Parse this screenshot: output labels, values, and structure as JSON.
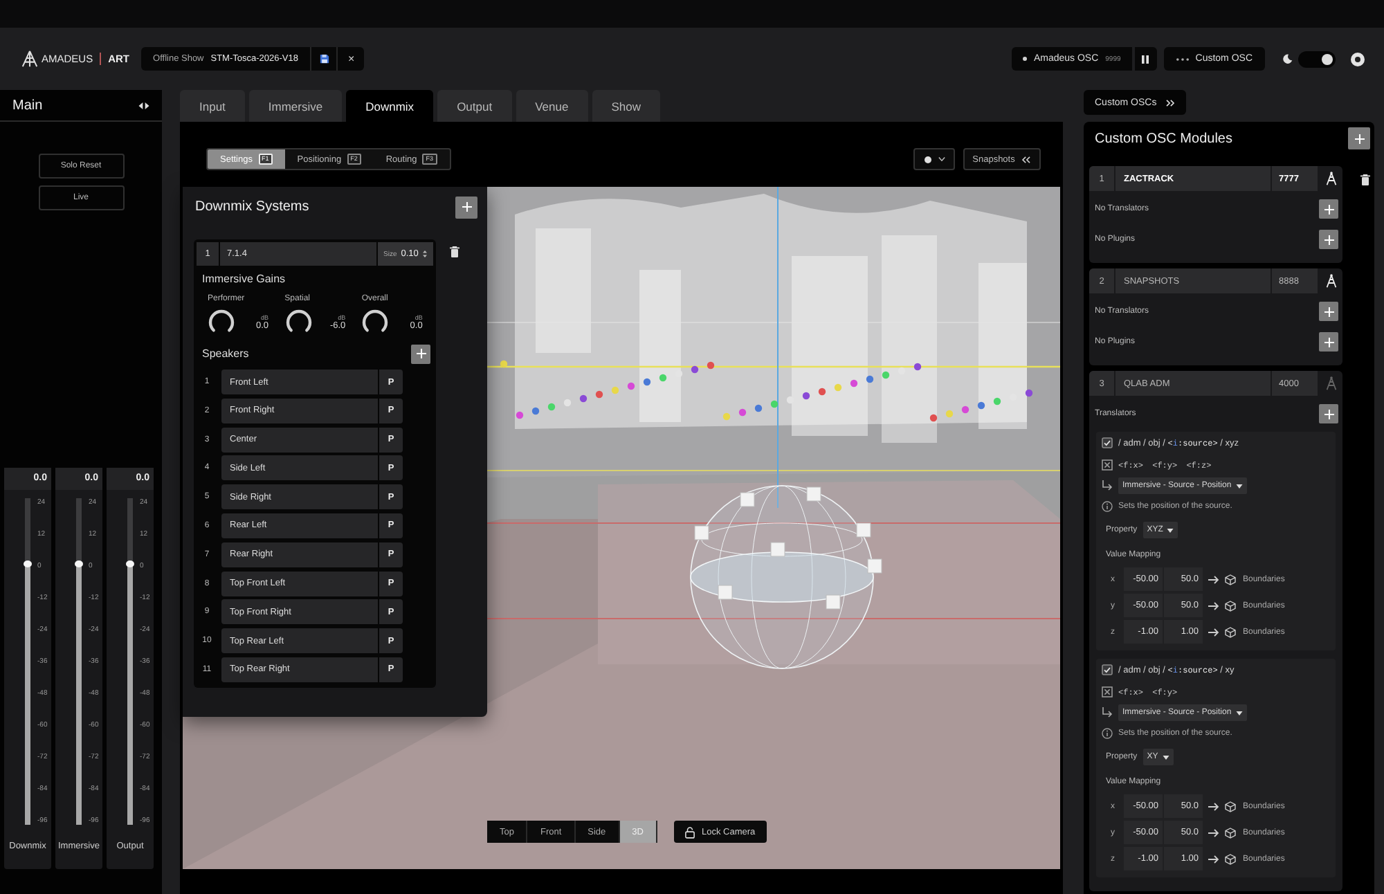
{
  "header": {
    "logo": {
      "brand": "AMADEUS",
      "product": "ART"
    },
    "show": {
      "label": "Offline Show",
      "name": "STM-Tosca-2026-V18",
      "close": "×"
    },
    "osc_status": {
      "label": "Amadeus OSC",
      "port": "9999"
    },
    "custom_osc": {
      "label": "Custom OSC"
    },
    "theme_switch": {
      "on": true
    }
  },
  "main_panel": {
    "title": "Main",
    "buttons": [
      "Solo Reset",
      "Live"
    ],
    "faders": [
      {
        "name": "Downmix",
        "reading": "0.0",
        "level": 0.8,
        "scale": [
          "24",
          "12",
          "0",
          "-12",
          "-24",
          "-36",
          "-48",
          "-60",
          "-72",
          "-84",
          "-96"
        ]
      },
      {
        "name": "Immersive",
        "reading": "0.0",
        "level": 0.8,
        "scale": [
          "24",
          "12",
          "0",
          "-12",
          "-24",
          "-36",
          "-48",
          "-60",
          "-72",
          "-84",
          "-96"
        ]
      },
      {
        "name": "Output",
        "reading": "0.0",
        "level": 0.8,
        "scale": [
          "24",
          "12",
          "0",
          "-12",
          "-24",
          "-36",
          "-48",
          "-60",
          "-72",
          "-84",
          "-96"
        ]
      }
    ]
  },
  "tabs": [
    {
      "label": "Input",
      "selected": false
    },
    {
      "label": "Immersive",
      "selected": false
    },
    {
      "label": "Downmix",
      "selected": true
    },
    {
      "label": "Output",
      "selected": false
    },
    {
      "label": "Venue",
      "selected": false
    },
    {
      "label": "Show",
      "selected": false
    }
  ],
  "editor": {
    "subtabs": [
      {
        "label": "Settings",
        "key": "F1",
        "selected": true
      },
      {
        "label": "Positioning",
        "key": "F2",
        "selected": false
      },
      {
        "label": "Routing",
        "key": "F3",
        "selected": false
      }
    ],
    "snapshots": "Snapshots",
    "downmix": {
      "title": "Downmix Systems",
      "system": {
        "index": "1",
        "name": "7.1.4",
        "size_label": "Size",
        "size": "0.10"
      },
      "gains_title": "Immersive Gains",
      "gains": [
        {
          "name": "Performer",
          "unit": "dB",
          "value": "0.0"
        },
        {
          "name": "Spatial",
          "unit": "dB",
          "value": "-6.0"
        },
        {
          "name": "Overall",
          "unit": "dB",
          "value": "0.0"
        }
      ],
      "speakers_title": "Speakers",
      "speakers": [
        {
          "index": "1",
          "name": "Front Left",
          "button": "P"
        },
        {
          "index": "2",
          "name": "Front Right",
          "button": "P"
        },
        {
          "index": "3",
          "name": "Center",
          "button": "P"
        },
        {
          "index": "4",
          "name": "Side Left",
          "button": "P"
        },
        {
          "index": "5",
          "name": "Side Right",
          "button": "P"
        },
        {
          "index": "6",
          "name": "Rear Left",
          "button": "P"
        },
        {
          "index": "7",
          "name": "Rear Right",
          "button": "P"
        },
        {
          "index": "8",
          "name": "Top Front Left",
          "button": "P"
        },
        {
          "index": "9",
          "name": "Top Front Right",
          "button": "P"
        },
        {
          "index": "10",
          "name": "Top Rear Left",
          "button": "P"
        },
        {
          "index": "11",
          "name": "Top Rear Right",
          "button": "P"
        }
      ]
    },
    "views": [
      {
        "label": "Top",
        "selected": false
      },
      {
        "label": "Front",
        "selected": false
      },
      {
        "label": "Side",
        "selected": false
      },
      {
        "label": "3D",
        "selected": true
      }
    ],
    "lock_camera": "Lock Camera"
  },
  "custom_osc": {
    "tab": "Custom OSCs",
    "title": "Custom OSC Modules",
    "modules": [
      {
        "index": "1",
        "name": "ZACTRACK",
        "port": "7777",
        "selected": true,
        "online": true,
        "translators_label": "No Translators",
        "plugins_label": "No Plugins"
      },
      {
        "index": "2",
        "name": "SNAPSHOTS",
        "port": "8888",
        "selected": false,
        "online": true,
        "translators_label": "No Translators",
        "plugins_label": "No Plugins"
      },
      {
        "index": "3",
        "name": "QLAB ADM",
        "port": "4000",
        "selected": false,
        "online": false,
        "translators_label": "Translators",
        "translators": [
          {
            "enabled": true,
            "address": [
              {
                "text": "/ adm / obj / ",
                "kind": "path"
              },
              {
                "text": "<",
                "kind": "arg"
              },
              {
                "text": "i",
                "kind": "type"
              },
              {
                "text": ":source>",
                "kind": "arg"
              },
              {
                "text": " / xyz",
                "kind": "path"
              }
            ],
            "args": "<f:x> <f:y> <f:z>",
            "target": "Immersive - Source - Position",
            "description": "Sets the position of the source.",
            "property_label": "Property",
            "property": "XYZ",
            "mapping_label": "Value Mapping",
            "mappings": [
              {
                "axis": "x",
                "min": "-50.00",
                "max": "50.0",
                "target": "Boundaries"
              },
              {
                "axis": "y",
                "min": "-50.00",
                "max": "50.0",
                "target": "Boundaries"
              },
              {
                "axis": "z",
                "min": "-1.00",
                "max": "1.00",
                "target": "Boundaries"
              }
            ]
          },
          {
            "enabled": true,
            "address": [
              {
                "text": "/ adm / obj / ",
                "kind": "path"
              },
              {
                "text": "<",
                "kind": "arg"
              },
              {
                "text": "i",
                "kind": "type"
              },
              {
                "text": ":source>",
                "kind": "arg"
              },
              {
                "text": " / xy",
                "kind": "path"
              }
            ],
            "args": "<f:x> <f:y>",
            "target": "Immersive - Source - Position",
            "description": "Sets the position of the source.",
            "property_label": "Property",
            "property": "XY",
            "mapping_label": "Value Mapping",
            "mappings": [
              {
                "axis": "x",
                "min": "-50.00",
                "max": "50.0",
                "target": "Boundaries"
              },
              {
                "axis": "y",
                "min": "-50.00",
                "max": "50.0",
                "target": "Boundaries"
              },
              {
                "axis": "z",
                "min": "-1.00",
                "max": "1.00",
                "target": "Boundaries"
              }
            ]
          }
        ]
      }
    ]
  }
}
